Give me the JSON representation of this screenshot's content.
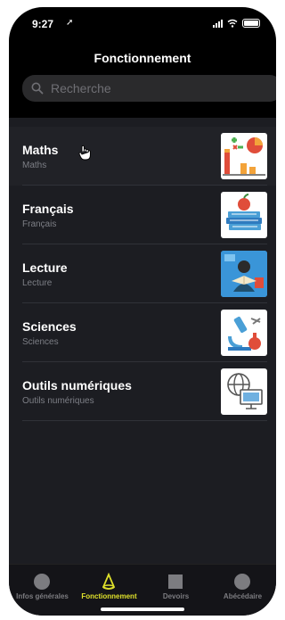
{
  "status_bar": {
    "time": "9:27",
    "location_glyph": "➚"
  },
  "header": {
    "title": "Fonctionnement"
  },
  "search": {
    "placeholder": "Recherche"
  },
  "items": [
    {
      "title": "Maths",
      "subtitle": "Maths",
      "icon": "chart-math-icon"
    },
    {
      "title": "Français",
      "subtitle": "Français",
      "icon": "books-apple-icon"
    },
    {
      "title": "Lecture",
      "subtitle": "Lecture",
      "icon": "reading-student-icon"
    },
    {
      "title": "Sciences",
      "subtitle": "Sciences",
      "icon": "microscope-icon"
    },
    {
      "title": "Outils numériques",
      "subtitle": "Outils numériques",
      "icon": "globe-computer-icon"
    }
  ],
  "tabs": [
    {
      "label": "Infos générales",
      "icon": "circle-icon",
      "active": false
    },
    {
      "label": "Fonctionnement",
      "icon": "cone-icon",
      "active": true
    },
    {
      "label": "Devoirs",
      "icon": "square-icon",
      "active": false
    },
    {
      "label": "Abécédaire",
      "icon": "circle-icon",
      "active": false
    }
  ],
  "colors": {
    "background": "#000000",
    "list_background": "#1c1d22",
    "accent": "#dfe12b",
    "inactive_tab": "#7c7c80"
  }
}
